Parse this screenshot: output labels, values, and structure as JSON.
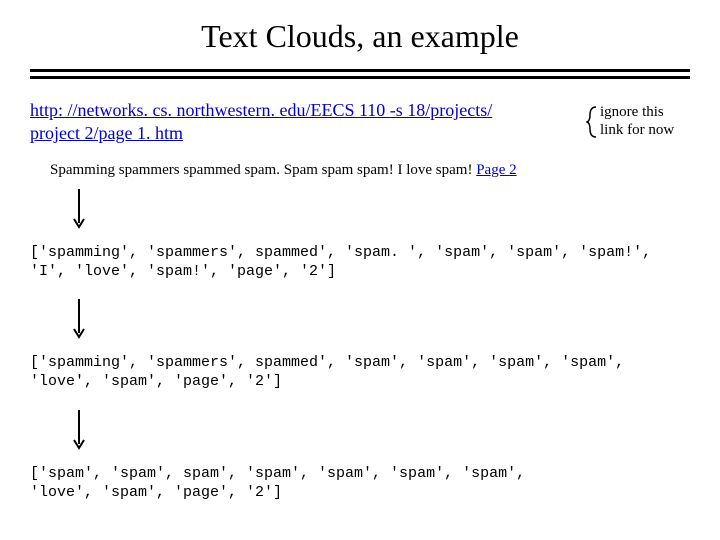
{
  "title": "Text Clouds, an example",
  "url": {
    "line1": "http: //networks. cs. northwestern. edu/EECS 110 -s 18/projects/",
    "line2": "project 2/page 1. htm"
  },
  "annotation": {
    "line1": "ignore this",
    "line2": "link for now"
  },
  "sentence": {
    "prefix": "Spamming spammers spammed spam. Spam spam spam! I love spam! ",
    "page2": "Page 2"
  },
  "list1": "['spamming', 'spammers', spammed', 'spam. ', 'spam', 'spam', 'spam!',\n'I', 'love', 'spam!', 'page', '2']",
  "list2": "['spamming', 'spammers', spammed', 'spam', 'spam', 'spam', 'spam',\n'love', 'spam', 'page', '2']",
  "list3": "['spam', 'spam', spam', 'spam', 'spam', 'spam', 'spam',\n'love', 'spam', 'page', '2']"
}
